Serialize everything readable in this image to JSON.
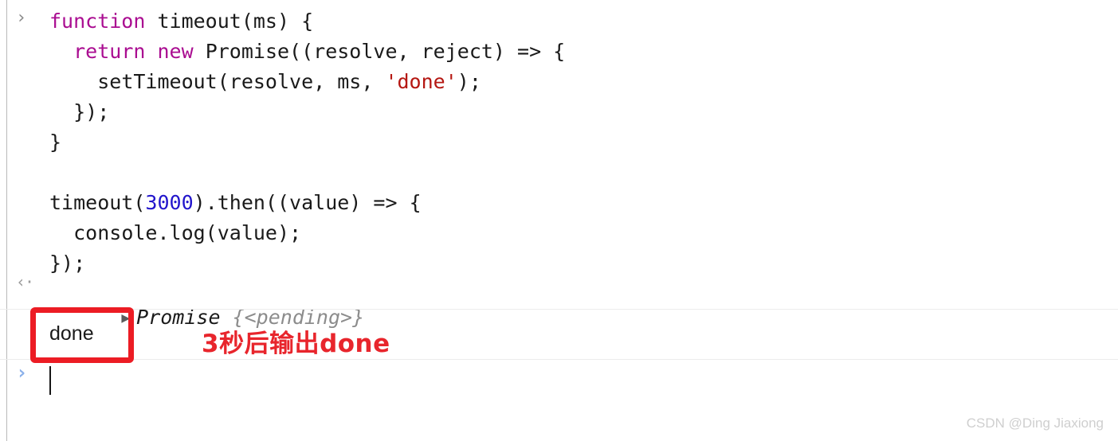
{
  "console": {
    "background_color": "#ffffff",
    "gutter_rule_color": "#b9b9b9",
    "separator_color": "#ececec",
    "input_prompt_icon": "›",
    "result_arrow_icon": "‹·",
    "active_prompt_icon": "›",
    "disclosure_triangle_icon": "▶"
  },
  "input_block": {
    "lines": [
      {
        "indent": "",
        "tokens": [
          {
            "text": "function",
            "type": "keyword"
          },
          {
            "text": " timeout(ms) {",
            "type": "plain"
          }
        ]
      },
      {
        "indent": "  ",
        "tokens": [
          {
            "text": "return",
            "type": "keyword"
          },
          {
            "text": " ",
            "type": "plain"
          },
          {
            "text": "new",
            "type": "keyword"
          },
          {
            "text": " Promise((resolve, reject) => {",
            "type": "plain"
          }
        ]
      },
      {
        "indent": "    ",
        "tokens": [
          {
            "text": "setTimeout(resolve, ms, ",
            "type": "plain"
          },
          {
            "text": "'done'",
            "type": "string"
          },
          {
            "text": ");",
            "type": "plain"
          }
        ]
      },
      {
        "indent": "  ",
        "tokens": [
          {
            "text": "});",
            "type": "plain"
          }
        ]
      },
      {
        "indent": "",
        "tokens": [
          {
            "text": "}",
            "type": "plain"
          }
        ]
      },
      {
        "indent": "",
        "tokens": [
          {
            "text": "",
            "type": "plain"
          }
        ]
      },
      {
        "indent": "",
        "tokens": [
          {
            "text": "timeout(",
            "type": "plain"
          },
          {
            "text": "3000",
            "type": "number"
          },
          {
            "text": ").then((value) => {",
            "type": "plain"
          }
        ]
      },
      {
        "indent": "  ",
        "tokens": [
          {
            "text": "console.log(value);",
            "type": "plain"
          }
        ]
      },
      {
        "indent": "",
        "tokens": [
          {
            "text": "});",
            "type": "plain"
          }
        ]
      }
    ]
  },
  "result_row": {
    "object_name": "Promise",
    "object_preview": "{<pending>}"
  },
  "log_row": {
    "text": "done"
  },
  "annotation": {
    "caption": "3秒后输出done",
    "color": "#e8252c",
    "box_color": "#ec1c24"
  },
  "watermark": {
    "text": "CSDN @Ding Jiaxiong"
  },
  "syntax_colors": {
    "keyword": "#aa0d91",
    "string": "#b51712",
    "number": "#2215cc",
    "plain": "#1a1a1a",
    "pending": "#8c8c8c"
  }
}
